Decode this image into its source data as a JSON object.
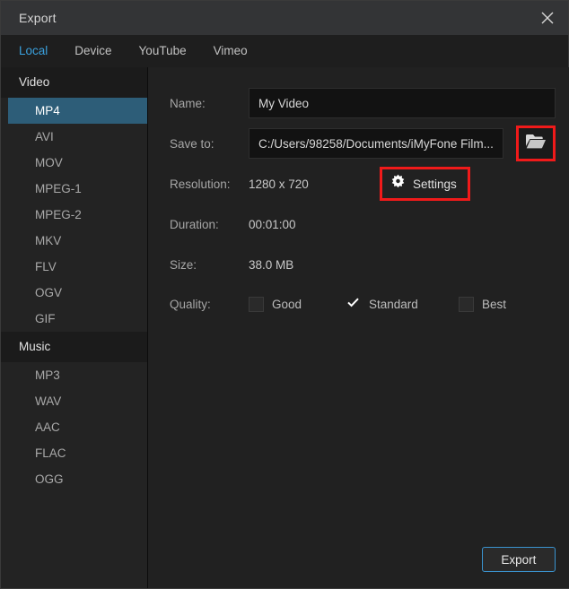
{
  "window": {
    "title": "Export",
    "close_icon": "close-icon"
  },
  "tabs": [
    {
      "label": "Local",
      "active": true
    },
    {
      "label": "Device",
      "active": false
    },
    {
      "label": "YouTube",
      "active": false
    },
    {
      "label": "Vimeo",
      "active": false
    }
  ],
  "sidebar": {
    "groups": [
      {
        "header": "Video",
        "items": [
          {
            "label": "MP4",
            "selected": true
          },
          {
            "label": "AVI",
            "selected": false
          },
          {
            "label": "MOV",
            "selected": false
          },
          {
            "label": "MPEG-1",
            "selected": false
          },
          {
            "label": "MPEG-2",
            "selected": false
          },
          {
            "label": "MKV",
            "selected": false
          },
          {
            "label": "FLV",
            "selected": false
          },
          {
            "label": "OGV",
            "selected": false
          },
          {
            "label": "GIF",
            "selected": false
          }
        ]
      },
      {
        "header": "Music",
        "items": [
          {
            "label": "MP3",
            "selected": false
          },
          {
            "label": "WAV",
            "selected": false
          },
          {
            "label": "AAC",
            "selected": false
          },
          {
            "label": "FLAC",
            "selected": false
          },
          {
            "label": "OGG",
            "selected": false
          }
        ]
      }
    ]
  },
  "form": {
    "name": {
      "label": "Name:",
      "value": "My Video",
      "placeholder": "My Video"
    },
    "save_to": {
      "label": "Save to:",
      "value": "C:/Users/98258/Documents/iMyFone Film...",
      "browse_icon": "folder-icon"
    },
    "resolution": {
      "label": "Resolution:",
      "value": "1280 x 720"
    },
    "settings": {
      "label": "Settings",
      "icon": "gear-icon"
    },
    "duration": {
      "label": "Duration:",
      "value": "00:01:00"
    },
    "size": {
      "label": "Size:",
      "value": "38.0 MB"
    },
    "quality": {
      "label": "Quality:",
      "options": [
        {
          "label": "Good",
          "checked": false
        },
        {
          "label": "Standard",
          "checked": true
        },
        {
          "label": "Best",
          "checked": false
        }
      ]
    }
  },
  "footer": {
    "export_label": "Export"
  },
  "colors": {
    "accent": "#3aa0dd",
    "selection": "#2d5d78",
    "highlight_box": "#f01a1a",
    "window_bg": "#1e1e1e",
    "panel_bg": "#212121",
    "sidebar_bg": "#232323"
  }
}
